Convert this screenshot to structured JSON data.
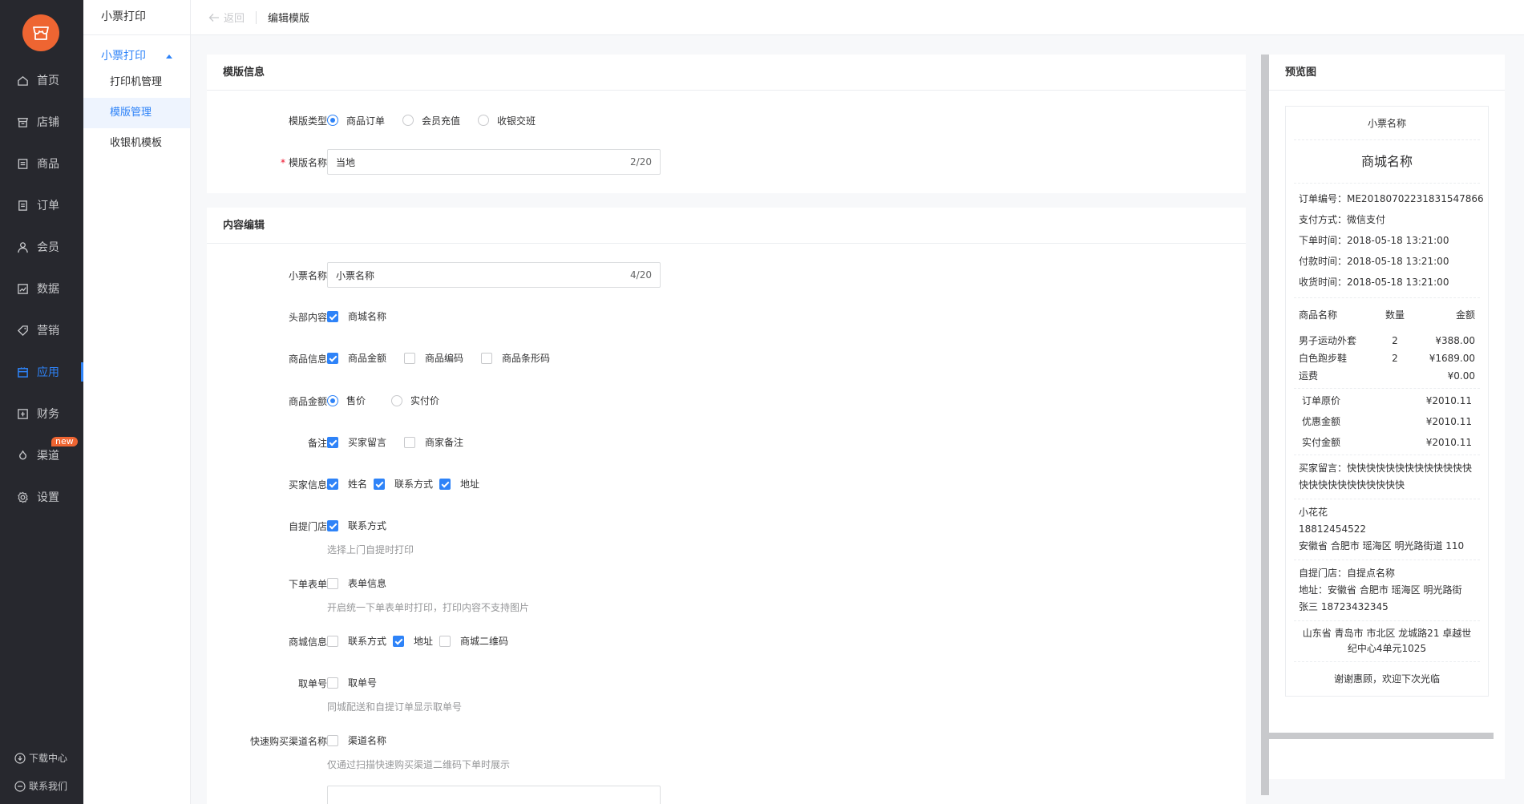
{
  "nav": {
    "items": [
      {
        "label": "首页",
        "icon": "home-icon"
      },
      {
        "label": "店铺",
        "icon": "store-icon"
      },
      {
        "label": "商品",
        "icon": "goods-icon"
      },
      {
        "label": "订单",
        "icon": "order-icon"
      },
      {
        "label": "会员",
        "icon": "member-icon"
      },
      {
        "label": "数据",
        "icon": "data-icon"
      },
      {
        "label": "营销",
        "icon": "tag-icon"
      },
      {
        "label": "应用",
        "icon": "app-icon",
        "active": true
      },
      {
        "label": "财务",
        "icon": "finance-icon"
      },
      {
        "label": "渠道",
        "icon": "channel-icon",
        "badge": "new"
      },
      {
        "label": "设置",
        "icon": "gear-icon"
      }
    ],
    "download_center": "下载中心",
    "contact_us": "联系我们"
  },
  "subnav": {
    "title": "小票打印",
    "group": "小票打印",
    "items": [
      "打印机管理",
      "模版管理",
      "收银机模板"
    ],
    "active_index": 1
  },
  "topbar": {
    "back": "返回",
    "breadcrumb": "编辑模版"
  },
  "template_info": {
    "heading": "模版信息",
    "type_label": "模版类型",
    "type_options": [
      "商品订单",
      "会员充值",
      "收银交班"
    ],
    "type_selected": 0,
    "name_label": "模版名称",
    "name_value": "当地",
    "name_count": "2/20"
  },
  "content_edit": {
    "heading": "内容编辑",
    "ticket_name_label": "小票名称",
    "ticket_name_value": "小票名称",
    "ticket_name_count": "4/20",
    "header_label": "头部内容",
    "header_opt": "商城名称",
    "goods_info_label": "商品信息",
    "goods_info_opts": [
      "商品金额",
      "商品编码",
      "商品条形码"
    ],
    "goods_amount_label": "商品金额",
    "goods_amount_opts": [
      "售价",
      "实付价"
    ],
    "remark_label": "备注",
    "remark_opts": [
      "买家留言",
      "商家备注"
    ],
    "buyer_label": "买家信息",
    "buyer_opts": [
      "姓名",
      "联系方式",
      "地址"
    ],
    "pickup_label": "自提门店",
    "pickup_opt": "联系方式",
    "pickup_hint": "选择上门自提时打印",
    "form_label": "下单表单",
    "form_opt": "表单信息",
    "form_hint": "开启统一下单表单时打印，打印内容不支持图片",
    "mall_label": "商城信息",
    "mall_opts": [
      "联系方式",
      "地址",
      "商城二维码"
    ],
    "take_label": "取单号",
    "take_opt": "取单号",
    "take_hint": "同城配送和自提订单显示取单号",
    "channel_label": "快速购买渠道名称",
    "channel_opt": "渠道名称",
    "channel_hint": "仅通过扫描快速购买渠道二维码下单时展示"
  },
  "preview": {
    "heading": "预览图",
    "ticket_name": "小票名称",
    "mall_name": "商城名称",
    "order_lines": [
      "订单编号：ME20180702231831547866",
      "支付方式：微信支付",
      "下单时间：2018-05-18 13:21:00",
      "付款时间：2018-05-18 13:21:00",
      "收货时间：2018-05-18 13:21:00"
    ],
    "goods_header": [
      "商品名称",
      "数量",
      "金额"
    ],
    "goods_rows": [
      [
        "男子运动外套",
        "2",
        "¥388.00"
      ],
      [
        "白色跑步鞋",
        "2",
        "¥1689.00"
      ],
      [
        "运费",
        "",
        "¥0.00"
      ]
    ],
    "sums": [
      [
        "订单原价",
        "¥2010.11"
      ],
      [
        "优惠金额",
        "¥2010.11"
      ],
      [
        "实付金额",
        "¥2010.11"
      ]
    ],
    "buyer_msg": "买家留言：快快快快快快快快快快快快快快快快快快快快快快快快",
    "buyer_name": "小花花",
    "buyer_phone": "18812454522",
    "buyer_addr": "安徽省 合肥市 瑶海区 明光路街道 110",
    "pickup_store": "自提门店：自提点名称",
    "pickup_addr": "地址：安徽省 合肥市 瑶海区 明光路街",
    "pickup_contact": "张三 18723432345",
    "mall_addr": "山东省 青岛市 市北区 龙城路21 卓越世纪中心4单元1025",
    "thanks": "谢谢惠顾，欢迎下次光临"
  }
}
